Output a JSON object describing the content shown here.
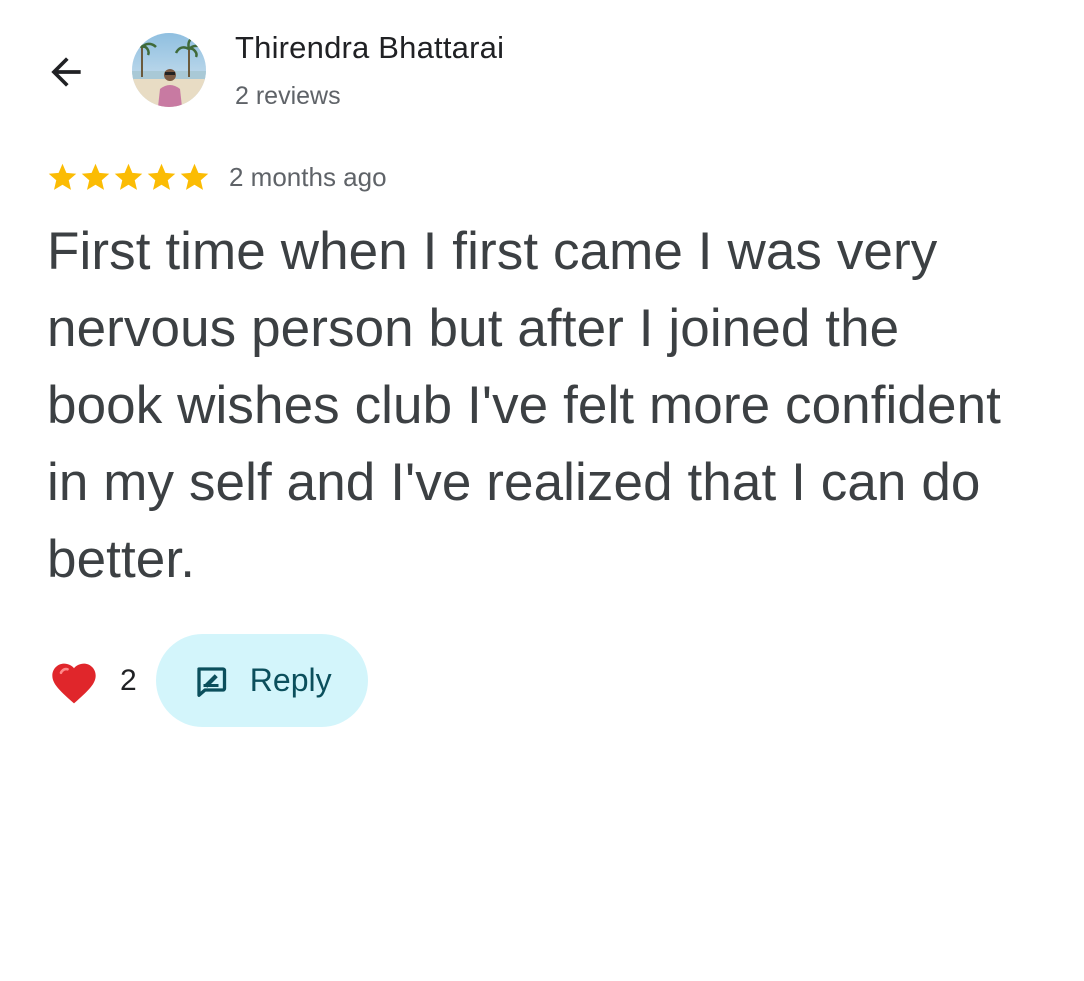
{
  "header": {
    "back_icon": "arrow-back-icon",
    "author_name": "Thirendra Bhattarai",
    "review_count": "2 reviews",
    "avatar_icon": "profile-photo"
  },
  "review": {
    "rating": 5,
    "rating_max": 5,
    "star_color": "#fbbc04",
    "time_ago": "2 months ago",
    "text": "First time when I first came I was very nervous person but after I joined the book wishes club I've felt more confident in my self and I've realized that I can do better."
  },
  "actions": {
    "like_icon": "heart-icon",
    "like_count": "2",
    "reply_icon": "reply-icon",
    "reply_label": "Reply",
    "reply_bg": "#d3f5fb"
  }
}
